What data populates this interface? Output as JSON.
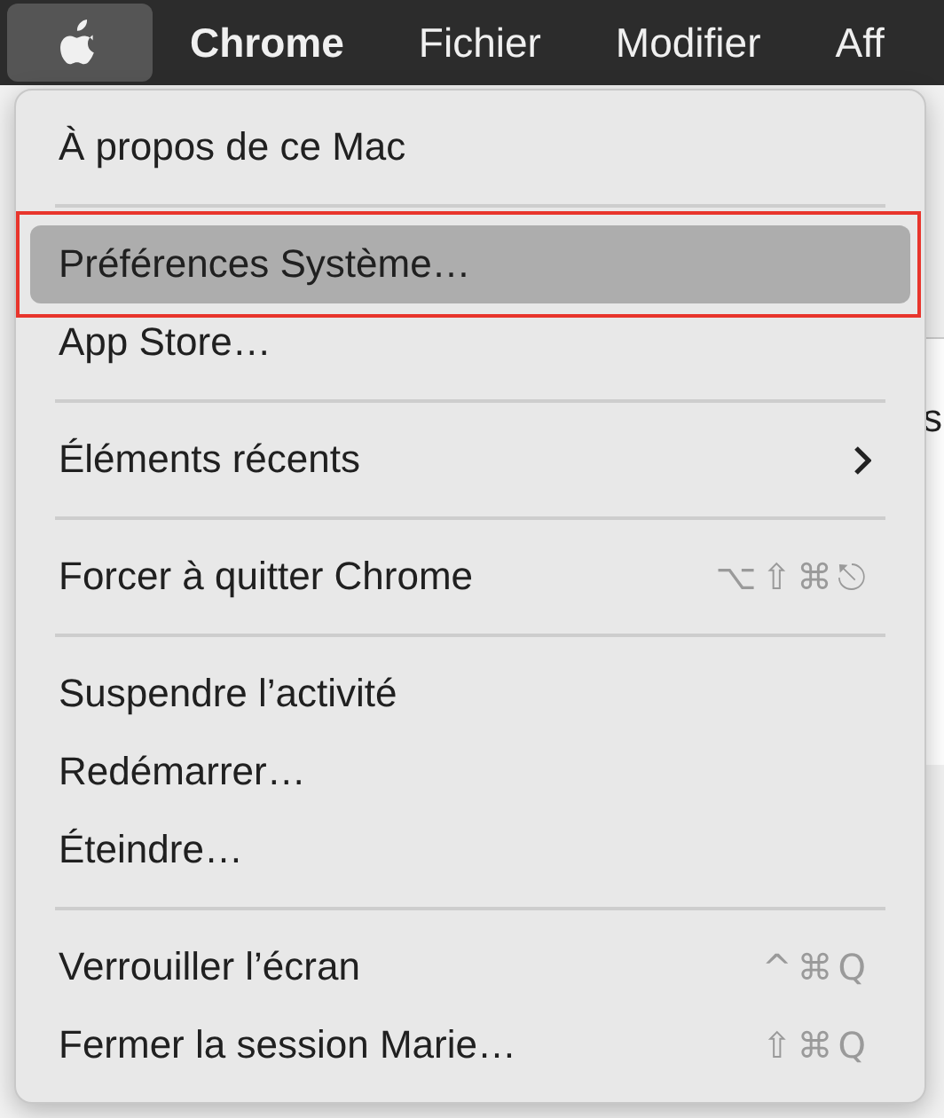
{
  "menu_bar": {
    "items": [
      {
        "kind": "apple",
        "selected": true
      },
      {
        "kind": "text",
        "label": "Chrome",
        "selected": false
      },
      {
        "kind": "text",
        "label": "Fichier",
        "selected": false
      },
      {
        "kind": "text",
        "label": "Modifier",
        "selected": false
      },
      {
        "kind": "text",
        "label": "Aff",
        "selected": false
      }
    ]
  },
  "background_window": {
    "text": "s"
  },
  "menu": {
    "items": [
      {
        "kind": "item",
        "label": "À propos de ce Mac",
        "selected": false
      },
      {
        "kind": "separator"
      },
      {
        "kind": "item",
        "label": "Préférences Système…",
        "selected": true,
        "annotated": true
      },
      {
        "kind": "item",
        "label": "App Store…",
        "selected": false
      },
      {
        "kind": "separator"
      },
      {
        "kind": "item",
        "label": "Éléments récents",
        "selected": false,
        "submenu": true
      },
      {
        "kind": "separator"
      },
      {
        "kind": "item",
        "label": "Forcer à quitter Chrome",
        "selected": false,
        "shortcut": "⌥⇧⌘⎋"
      },
      {
        "kind": "separator"
      },
      {
        "kind": "item",
        "label": "Suspendre l’activité",
        "selected": false
      },
      {
        "kind": "item",
        "label": "Redémarrer…",
        "selected": false
      },
      {
        "kind": "item",
        "label": "Éteindre…",
        "selected": false
      },
      {
        "kind": "separator"
      },
      {
        "kind": "item",
        "label": "Verrouiller l’écran",
        "selected": false,
        "shortcut": "^⌘Q"
      },
      {
        "kind": "item",
        "label": "Fermer la session Marie…",
        "selected": false,
        "shortcut": "⇧⌘Q"
      }
    ]
  }
}
